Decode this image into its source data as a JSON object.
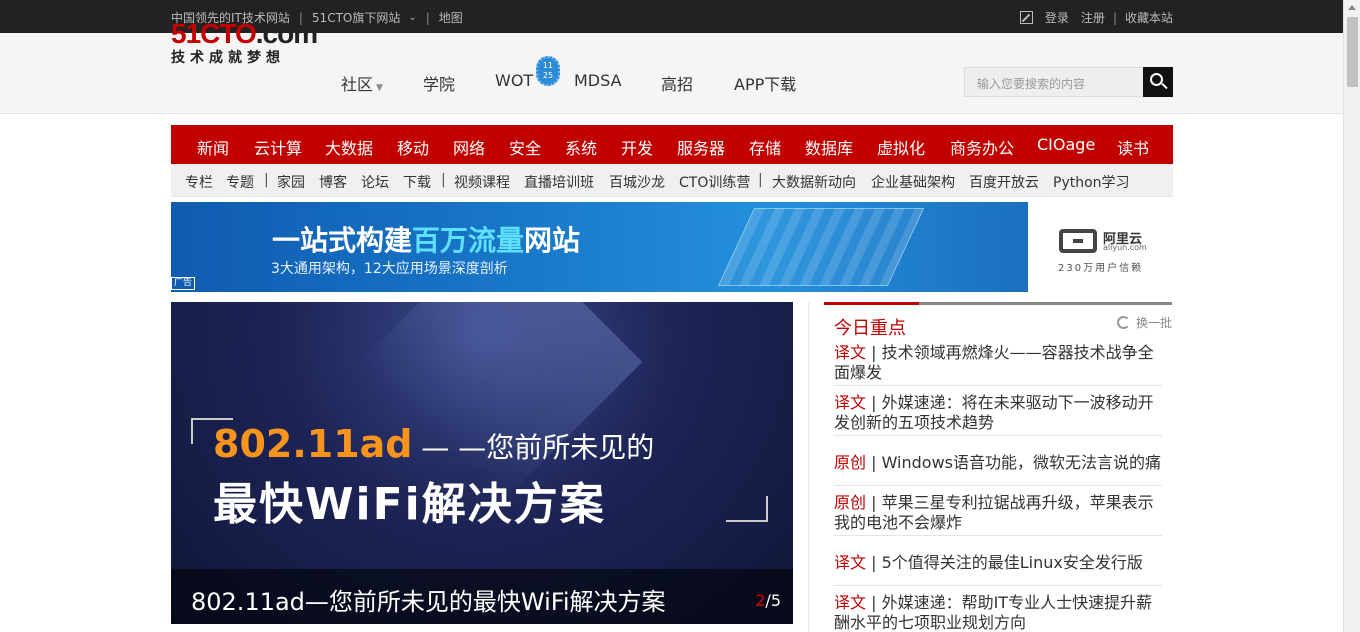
{
  "topbar": {
    "left": [
      "中国领先的IT技术网站",
      "51CTO旗下网站",
      "地图"
    ],
    "right": [
      "登录",
      "注册",
      "收藏本站"
    ]
  },
  "logo": {
    "main": "51CTO",
    "suffix": ".com",
    "slogan": "技术成就梦想"
  },
  "mainnav": [
    "社区",
    "学院",
    "WOT",
    "MDSA",
    "高招",
    "APP下载"
  ],
  "wot_badge": {
    "top": "11",
    "bottom": "25"
  },
  "search": {
    "placeholder": "输入您要搜索的内容"
  },
  "rednav": [
    "新闻",
    "云计算",
    "大数据",
    "移动",
    "网络",
    "安全",
    "系统",
    "开发",
    "服务器",
    "存储",
    "数据库",
    "虚拟化",
    "商务办公",
    "CIOage",
    "读书"
  ],
  "subnav": [
    "专栏",
    "专题",
    "家园",
    "博客",
    "论坛",
    "下载",
    "视频课程",
    "直播培训班",
    "百城沙龙",
    "CTO训练营",
    "大数据新动向",
    "企业基础架构",
    "百度开放云",
    "Python学习"
  ],
  "ad": {
    "title_pre": "一站式构建",
    "title_hl": "百万流量",
    "title_post": "网站",
    "subtitle": "3大通用架构，12大应用场景深度剖析",
    "tag": "广告",
    "brand": "阿里云",
    "brand_en": "aliyun.com",
    "users": "230万用户信赖"
  },
  "slider": {
    "headline_1a": "802.11ad",
    "headline_1b": " — —您前所未见的",
    "headline_2": "最快WiFi解决方案",
    "caption": "802.11ad—您前所未见的最快WiFi解决方案",
    "page_current": "2",
    "page_total": "/5"
  },
  "focus": {
    "title": "今日重点",
    "refresh": "换一批",
    "items": [
      {
        "tag": "译文",
        "text": " | 技术领域再燃烽火——容器技术战争全面爆发"
      },
      {
        "tag": "译文",
        "text": " | 外媒速递：将在未来驱动下一波移动开发创新的五项技术趋势"
      },
      {
        "tag": "原创",
        "text": " | Windows语音功能，微软无法言说的痛"
      },
      {
        "tag": "原创",
        "text": " | 苹果三星专利拉锯战再升级，苹果表示我的电池不会爆炸"
      },
      {
        "tag": "译文",
        "text": " | 5个值得关注的最佳Linux安全发行版"
      },
      {
        "tag": "译文",
        "text": " | 外媒速递：帮助IT专业人士快速提升薪酬水平的七项职业规划方向"
      }
    ]
  }
}
